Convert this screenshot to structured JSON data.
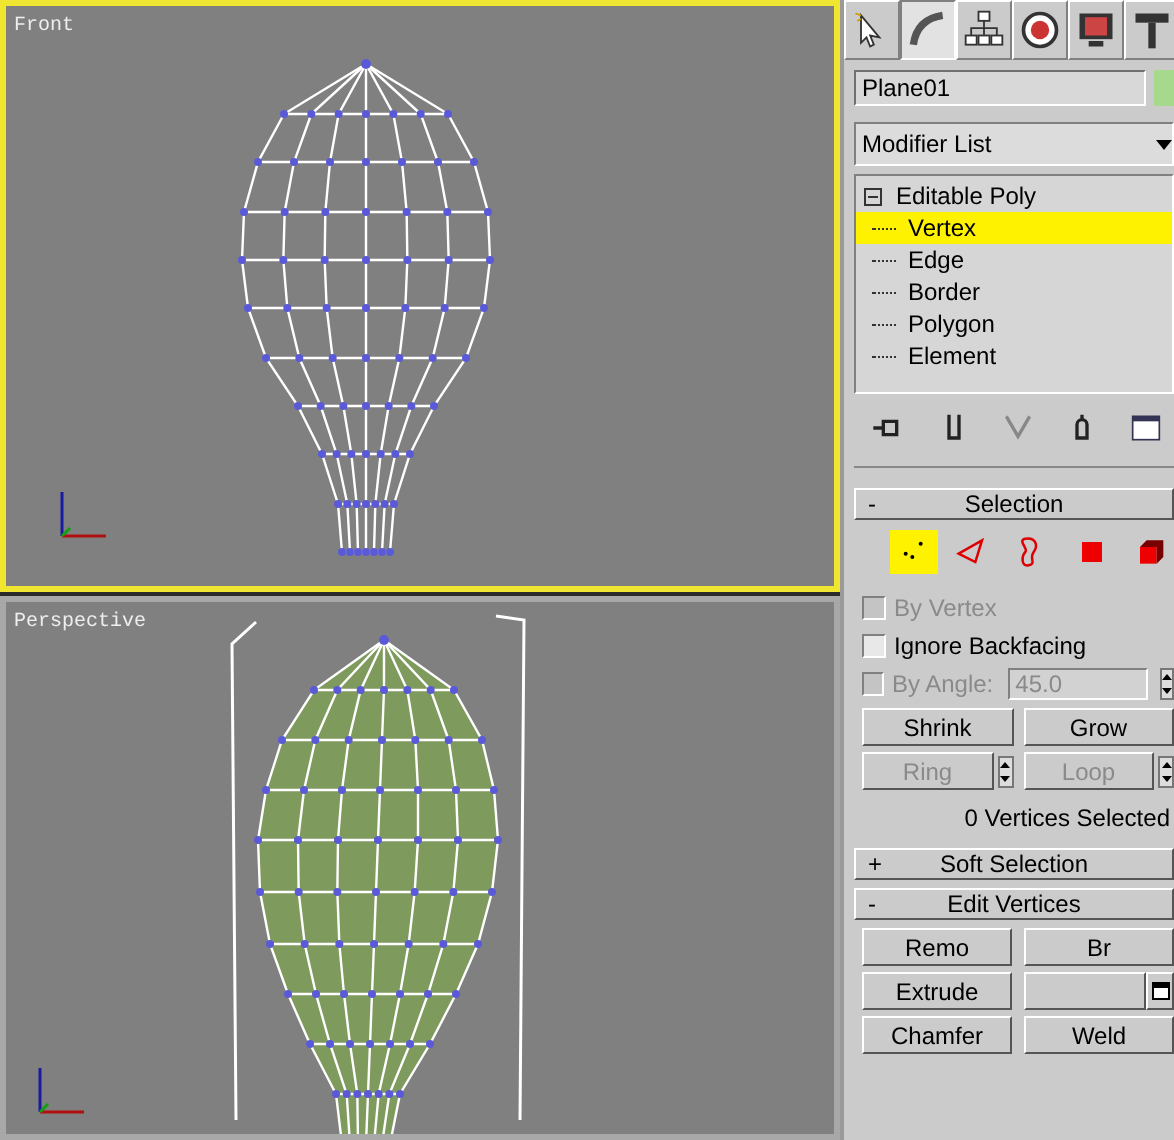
{
  "viewports": [
    {
      "label": "Front",
      "active": true,
      "kind": "wireframe"
    },
    {
      "label": "Perspective",
      "active": false,
      "kind": "smooth"
    }
  ],
  "command_panel": {
    "tabs": [
      {
        "selected": false
      },
      {
        "selected": true
      },
      {
        "selected": false
      },
      {
        "selected": false
      },
      {
        "selected": false
      },
      {
        "selected": false
      }
    ],
    "object_name": "Plane01",
    "modifier_list": "Modifier List",
    "stack": [
      {
        "label": "Editable Poly",
        "expanded": true,
        "selected": false,
        "children": [
          {
            "label": "Vertex",
            "selected": true
          },
          {
            "label": "Edge",
            "selected": false
          },
          {
            "label": "Border",
            "selected": false
          },
          {
            "label": "Polygon",
            "selected": false
          },
          {
            "label": "Element",
            "selected": false
          }
        ]
      }
    ],
    "rollouts": [
      {
        "kind": "selection",
        "toggle": "-",
        "title": "Selection",
        "subobjects": [
          {
            "selected": true
          },
          {
            "selected": false
          },
          {
            "selected": false
          },
          {
            "selected": false
          },
          {
            "selected": false
          }
        ],
        "checkboxes": [
          {
            "label": "By Vertex",
            "checked": false,
            "disabled": true
          },
          {
            "label": "Ignore Backfacing",
            "checked": false,
            "disabled": false
          },
          {
            "label": "By Angle:",
            "checked": false,
            "disabled": true,
            "value": "45.0"
          }
        ],
        "button_rows": [
          [
            {
              "label": "Shrink",
              "disabled": false,
              "spinner": false
            },
            {
              "label": "Grow",
              "disabled": false,
              "spinner": false
            }
          ],
          [
            {
              "label": "Ring",
              "disabled": true,
              "spinner": true
            },
            {
              "label": "Loop",
              "disabled": true,
              "spinner": true
            }
          ]
        ],
        "status": "0 Vertices Selected"
      },
      {
        "toggle": "+",
        "title": "Soft Selection"
      },
      {
        "kind": "edit_vertices",
        "toggle": "-",
        "title": "Edit Vertices",
        "buttons": [
          {
            "label": "Remo",
            "settings": false
          },
          {
            "label": "Br",
            "settings": false
          },
          {
            "label": "Extrude",
            "settings": false
          },
          {
            "settings": true
          },
          {
            "label": "Chamfer",
            "settings": false
          },
          {
            "label": "Weld",
            "settings": false
          }
        ]
      }
    ]
  }
}
